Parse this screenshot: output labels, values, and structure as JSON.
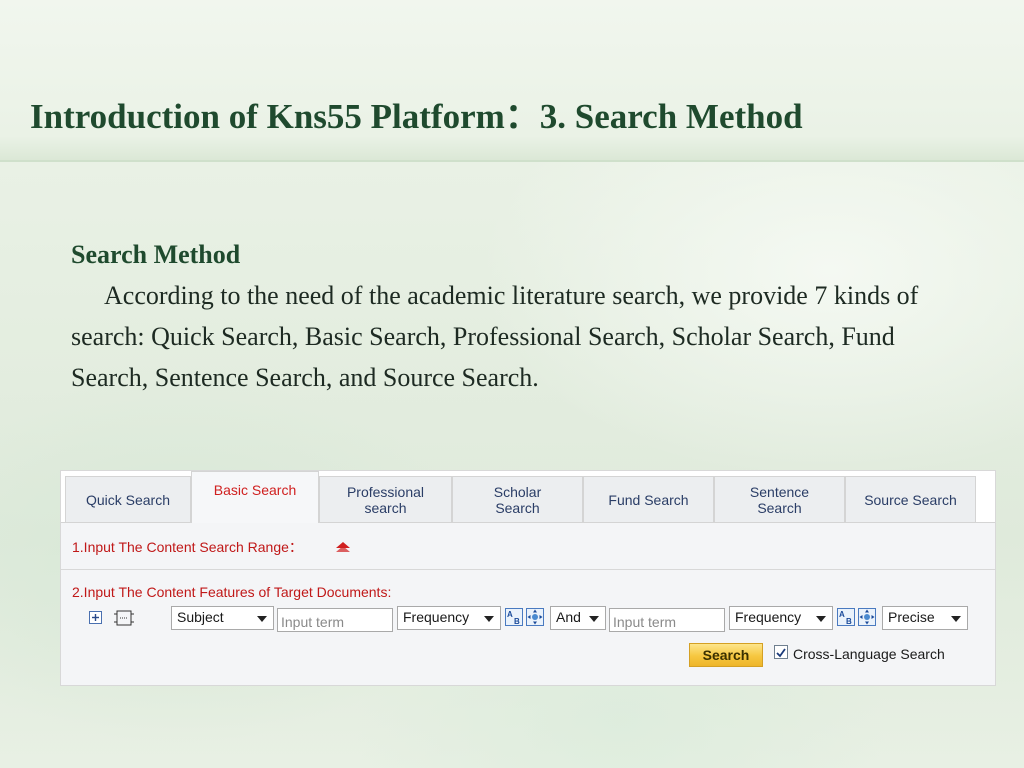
{
  "slide": {
    "title": "Introduction of Kns55 Platform：3. Search Method",
    "heading": "Search Method",
    "paragraph": "According to the need of the academic literature search, we provide 7 kinds of search: Quick Search, Basic Search, Professional Search, Scholar Search, Fund Search, Sentence Search, and Source Search."
  },
  "tabs": [
    {
      "line1": "Quick Search",
      "line2": "",
      "active": false
    },
    {
      "line1": "Basic Search",
      "line2": "",
      "active": true
    },
    {
      "line1": "Professional",
      "line2": "search",
      "active": false
    },
    {
      "line1": "Scholar",
      "line2": "Search",
      "active": false
    },
    {
      "line1": "Fund Search",
      "line2": "",
      "active": false
    },
    {
      "line1": "Sentence",
      "line2": "Search",
      "active": false
    },
    {
      "line1": "Source Search",
      "line2": "",
      "active": false
    }
  ],
  "section1": {
    "label": "1.Input The Content Search Range："
  },
  "section2": {
    "label": "2.Input The Content Features of Target Documents:",
    "field_select": "Subject",
    "term1_placeholder": "Input term",
    "frequency1": "Frequency",
    "logic_select": "And",
    "term2_placeholder": "Input term",
    "frequency2": "Frequency",
    "match_select": "Precise",
    "search_button": "Search",
    "cross_language_label": "Cross-Language Search",
    "cross_language_checked": true
  },
  "colors": {
    "title": "#1f4a2e",
    "active_tab_text": "#d02020",
    "section_label": "#c01818",
    "search_button": "#f6c740"
  },
  "icons": [
    "plus-icon",
    "grid-icon",
    "triangle-up-icon",
    "ab-icon",
    "expand-icon",
    "chevron-down-icon",
    "checkmark-icon"
  ]
}
